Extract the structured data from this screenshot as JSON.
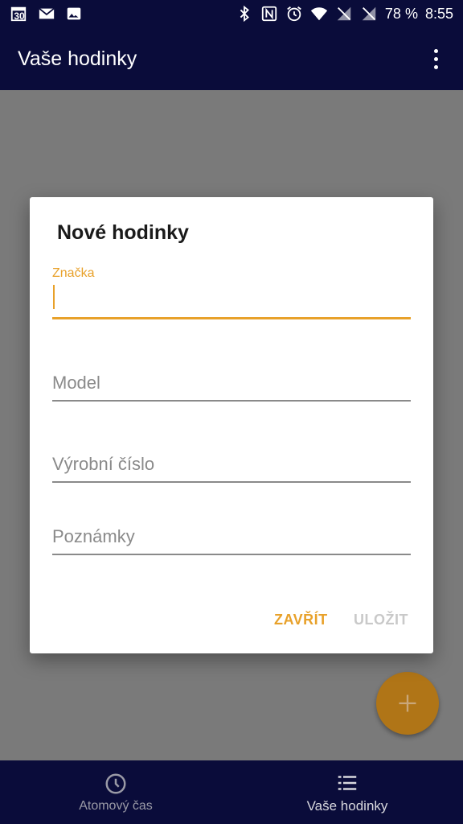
{
  "status_bar": {
    "calendar_day": "30",
    "battery": "78 %",
    "time": "8:55",
    "icons": [
      "calendar-icon",
      "gmail-icon",
      "image-icon",
      "bluetooth-icon",
      "nfc-icon",
      "alarm-icon",
      "wifi-icon",
      "signal-off-icon",
      "signal-off-icon"
    ]
  },
  "app_bar": {
    "title": "Vaše hodinky"
  },
  "dialog": {
    "title": "Nové hodinky",
    "fields": {
      "brand": {
        "label": "Značka",
        "value": ""
      },
      "model": {
        "placeholder": "Model"
      },
      "serial": {
        "placeholder": "Výrobní číslo"
      },
      "notes": {
        "placeholder": "Poznámky"
      }
    },
    "buttons": {
      "close": "ZAVŘÍT",
      "save": "ULOŽIT"
    }
  },
  "fab": {
    "icon": "plus-icon"
  },
  "bottom_nav": {
    "items": [
      {
        "label": "Atomový čas",
        "icon": "clock-icon"
      },
      {
        "label": "Vaše hodinky",
        "icon": "list-icon"
      }
    ]
  },
  "colors": {
    "primary": "#0a0c3a",
    "accent": "#e8a12a",
    "scrim": "#7a7a7a"
  }
}
